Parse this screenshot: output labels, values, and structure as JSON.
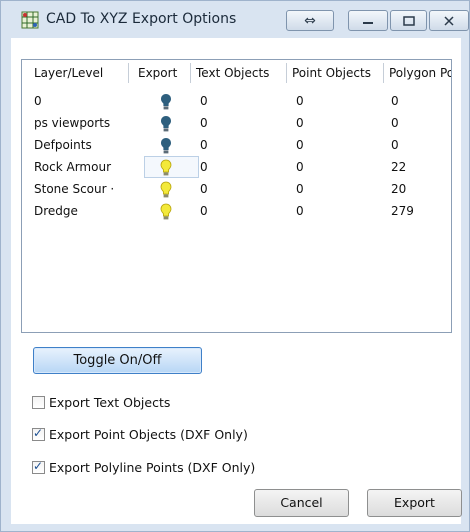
{
  "window": {
    "title": "CAD To XYZ Export Options"
  },
  "table": {
    "columns": [
      "Layer/Level",
      "Export",
      "Text Objects",
      "Point Objects",
      "Polygon Poir"
    ],
    "rows": [
      {
        "layer": "0",
        "export": "off",
        "text": "0",
        "point": "0",
        "polygon": "0"
      },
      {
        "layer": "ps viewports",
        "export": "off",
        "text": "0",
        "point": "0",
        "polygon": "0"
      },
      {
        "layer": "Defpoints",
        "export": "off",
        "text": "0",
        "point": "0",
        "polygon": "0"
      },
      {
        "layer": "Rock Armour",
        "export": "on",
        "text": "0",
        "point": "0",
        "polygon": "22"
      },
      {
        "layer": "Stone Scour ·",
        "export": "on",
        "text": "0",
        "point": "0",
        "polygon": "20"
      },
      {
        "layer": "Dredge",
        "export": "on",
        "text": "0",
        "point": "0",
        "polygon": "279"
      }
    ],
    "selected_row": 3
  },
  "toggle_button": {
    "label": "Toggle On/Off"
  },
  "checkboxes": [
    {
      "label": "Export Text Objects",
      "checked": false
    },
    {
      "label": "Export Point Objects (DXF Only)",
      "checked": true
    },
    {
      "label": "Export Polyline Points (DXF Only)",
      "checked": true
    }
  ],
  "buttons": {
    "cancel": "Cancel",
    "export": "Export"
  },
  "icons": {
    "bulb_off_color": "#2e5f7e",
    "bulb_on_color": "#f3e93a"
  }
}
